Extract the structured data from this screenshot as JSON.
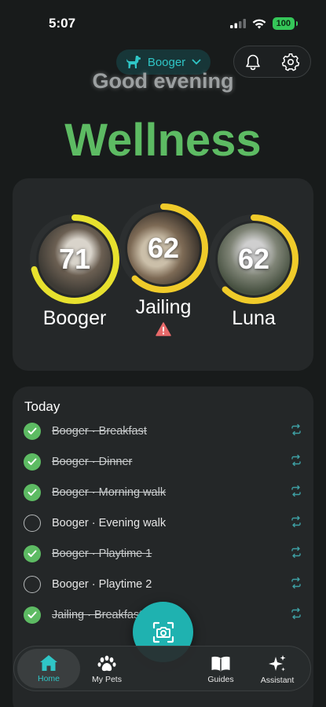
{
  "status_bar": {
    "time": "5:07",
    "battery": "100"
  },
  "header": {
    "pet_selector": {
      "label": "Booger",
      "icon": "dog-icon"
    },
    "greeting": "Good evening",
    "title": "Wellness"
  },
  "colors": {
    "accent": "#2fc6c6",
    "green": "#5dbb63",
    "ring_yellow": "#f0d22b",
    "warning": "#e86a6a"
  },
  "wellness": {
    "pets": [
      {
        "name": "Booger",
        "score": "71",
        "score_value": 71
      },
      {
        "name": "Jailing",
        "score": "62",
        "score_value": 62,
        "warning": true
      },
      {
        "name": "Luna",
        "score": "62",
        "score_value": 62
      }
    ]
  },
  "today": {
    "title": "Today",
    "tasks": [
      {
        "label": "Booger · Breakfast",
        "done": true
      },
      {
        "label": "Booger · Dinner",
        "done": true
      },
      {
        "label": "Booger · Morning walk",
        "done": true
      },
      {
        "label": "Booger · Evening walk",
        "done": false
      },
      {
        "label": "Booger · Playtime 1",
        "done": true
      },
      {
        "label": "Booger · Playtime 2",
        "done": false
      },
      {
        "label": "Jailing · Breakfast",
        "done": true
      }
    ]
  },
  "tab_bar": {
    "tabs": [
      {
        "label": "Home",
        "icon": "home-icon",
        "active": true
      },
      {
        "label": "My Pets",
        "icon": "paw-icon"
      },
      {
        "label": "Guides",
        "icon": "book-icon"
      },
      {
        "label": "Assistant",
        "icon": "sparkle-icon"
      }
    ],
    "camera": {
      "icon": "camera-scan-icon"
    }
  }
}
